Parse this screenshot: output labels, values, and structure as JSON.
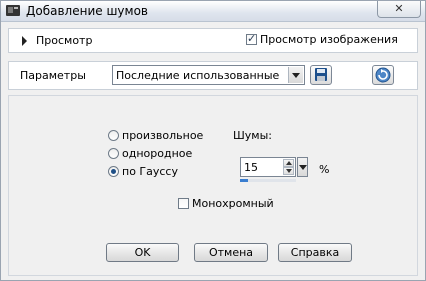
{
  "window": {
    "title": "Добавление шумов",
    "close_label": "✕"
  },
  "preview": {
    "label": "Просмотр",
    "checkbox_label": "Просмотр изображения",
    "checked": true
  },
  "params": {
    "label": "Параметры",
    "preset_value": "Последние использованные"
  },
  "options": {
    "distribution": [
      {
        "label": "произвольное",
        "selected": false
      },
      {
        "label": "однородное",
        "selected": false
      },
      {
        "label": "по Гауссу",
        "selected": true
      }
    ],
    "noise_label": "Шумы:",
    "noise_value": "15",
    "unit": "%",
    "mono_label": "Монохромный",
    "mono_checked": false
  },
  "buttons": {
    "ok": "OK",
    "cancel": "Отмена",
    "help": "Справка"
  }
}
